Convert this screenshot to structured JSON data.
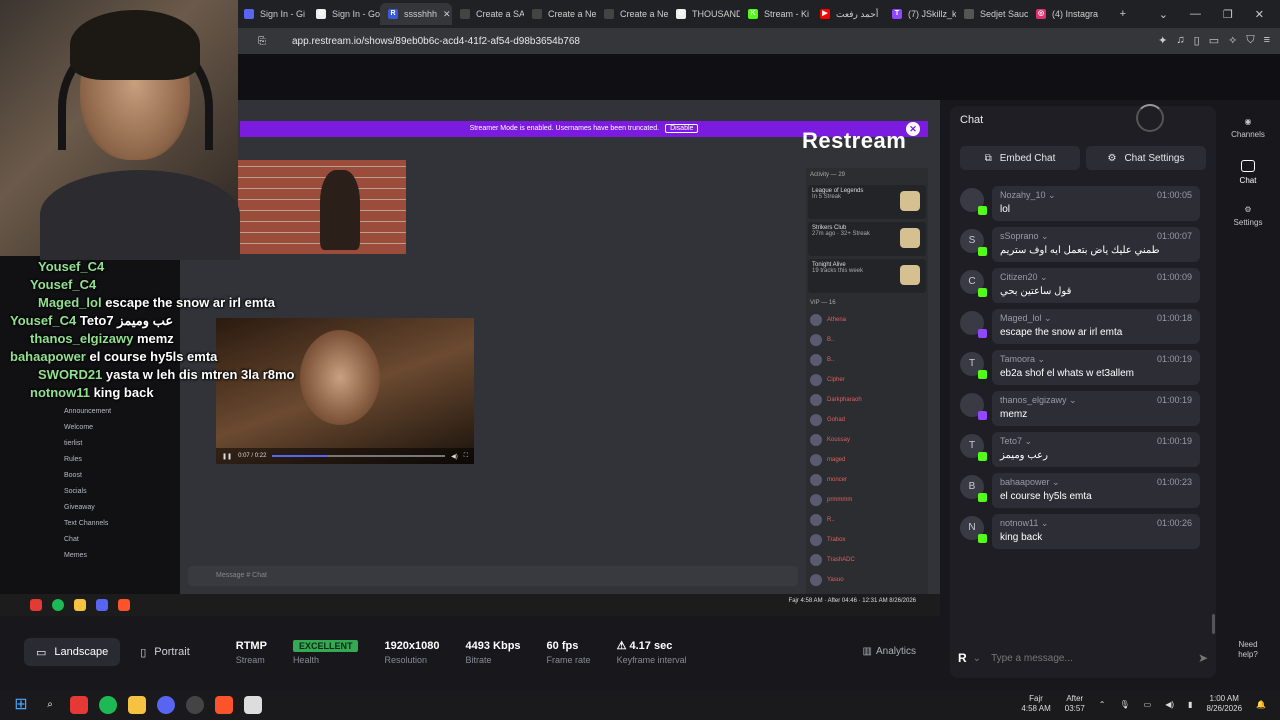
{
  "browser": {
    "tabs": [
      {
        "label": "Sign In - Gi",
        "color": "#5865f2",
        "glyph": ""
      },
      {
        "label": "Sign In - Go",
        "color": "#eee",
        "glyph": "G"
      },
      {
        "label": "sssshhh",
        "color": "#3b5bdb",
        "glyph": "R",
        "active": true
      },
      {
        "label": "Create a SA",
        "color": "#444",
        "glyph": ""
      },
      {
        "label": "Create a Ne",
        "color": "#444",
        "glyph": ""
      },
      {
        "label": "Create a Ne",
        "color": "#444",
        "glyph": ""
      },
      {
        "label": "THOUSAND",
        "color": "#eee",
        "glyph": "G"
      },
      {
        "label": "Stream - Ki",
        "color": "#53fc18",
        "glyph": "K"
      },
      {
        "label": "أحمد رفعت",
        "color": "#ff0000",
        "glyph": "▶"
      },
      {
        "label": "(7) JSkillz_k",
        "color": "#9146ff",
        "glyph": "T"
      },
      {
        "label": "Sedjet Sauc",
        "color": "#555",
        "glyph": ""
      },
      {
        "label": "(4) Instagra",
        "color": "#e1306c",
        "glyph": "◎"
      }
    ],
    "url": "app.restream.io/shows/89eb0b6c-acd4-41f2-af54-d98b3654b768"
  },
  "preview": {
    "streamer_mode": "Streamer Mode is enabled. Usernames have been truncated.",
    "disable": "Disable",
    "brand": "Restream",
    "video_time": "0:07 / 0:22",
    "video_progress": 0.32,
    "activity_title": "Activity — 29",
    "activity": [
      {
        "name": "League of Legends",
        "sub": "In 5 Streak"
      },
      {
        "name": "Strikers Club",
        "sub": "27m ago · 32+ Streak"
      },
      {
        "name": "Tonight Alive",
        "sub": "19 tracks this week"
      }
    ],
    "vip_title": "VIP — 16",
    "members": [
      "Athena",
      "B..",
      "B..",
      "Cipher",
      "Darkpharaoh",
      "Gohad",
      "Koussay",
      "maged",
      "moncer",
      "prmmmm",
      "R..",
      "Trabox",
      "TrashADC",
      "Yasuo"
    ],
    "overlay": [
      {
        "user": "Yousef_C4",
        "text": ""
      },
      {
        "user": "Yousef_C4",
        "text": ""
      },
      {
        "user": "Maged_lol",
        "text": "escape the snow ar irl emta"
      },
      {
        "user": "Yousef_C4",
        "text": "Teto7 عب وميمز"
      },
      {
        "user": "thanos_elgizawy",
        "text": "memz"
      },
      {
        "user": "bahaapower",
        "text": "el course hy5ls emta"
      },
      {
        "user": "SWORD21",
        "text": "yasta w leh dis mtren 3la r8mo"
      },
      {
        "user": "notnow11",
        "text": "king back"
      }
    ],
    "channels": [
      "Announcement",
      "Welcome",
      "tierlist",
      "Rules",
      "Boost",
      "Socials",
      "Giveaway",
      "Text Channels",
      "Chat",
      "Memes"
    ],
    "message_placeholder": "Message # Chat",
    "inner_clock": [
      "Fajr 4:58 AM",
      "After 04:46",
      "12:31 AM 8/26/2026"
    ]
  },
  "stats": {
    "landscape": "Landscape",
    "portrait": "Portrait",
    "protocol": "RTMP",
    "protocol_l": "Stream",
    "health": "EXCELLENT",
    "health_l": "Health",
    "resolution": "1920x1080",
    "resolution_l": "Resolution",
    "bitrate": "4493 Kbps",
    "bitrate_l": "Bitrate",
    "fps": "60 fps",
    "fps_l": "Frame rate",
    "keyframe": "4.17 sec",
    "keyframe_l": "Keyframe interval",
    "analytics": "Analytics"
  },
  "chat": {
    "title": "Chat",
    "embed": "Embed Chat",
    "settings": "Chat Settings",
    "placeholder": "Type a message...",
    "messages": [
      {
        "user": "Nozahy_10",
        "time": "01:00:05",
        "text": "lol",
        "platform": "kick",
        "initial": ""
      },
      {
        "user": "sSoprano",
        "time": "01:00:07",
        "text": "طمني عليك ياض بتعمل ايه اوف ستريم",
        "platform": "kick",
        "initial": "S"
      },
      {
        "user": "Citizen20",
        "time": "01:00:09",
        "text": "قول ساعتين بحي",
        "platform": "kick",
        "initial": "C"
      },
      {
        "user": "Maged_lol",
        "time": "01:00:18",
        "text": "escape the snow ar irl emta",
        "platform": "twitch",
        "initial": ""
      },
      {
        "user": "Tamoora",
        "time": "01:00:19",
        "text": "eb2a shof el whats w et3allem",
        "platform": "kick",
        "initial": "T"
      },
      {
        "user": "thanos_elgizawy",
        "time": "01:00:19",
        "text": "memz",
        "platform": "twitch",
        "initial": ""
      },
      {
        "user": "Teto7",
        "time": "01:00:19",
        "text": "رعب وميمز",
        "platform": "kick",
        "initial": "T"
      },
      {
        "user": "bahaapower",
        "time": "01:00:23",
        "text": "el course hy5ls emta",
        "platform": "kick",
        "initial": "B"
      },
      {
        "user": "notnow11",
        "time": "01:00:26",
        "text": "king back",
        "platform": "kick",
        "initial": "N"
      }
    ]
  },
  "rail": {
    "channels": "Channels",
    "chat": "Chat",
    "settings": "Settings",
    "help": "Need help?"
  },
  "taskbar": {
    "prayer": "Fajr",
    "prayer_time": "4:58 AM",
    "after": "After",
    "after_time": "03:57",
    "time": "1:00 AM",
    "date": "8/26/2026"
  },
  "colors": {
    "kick": "#53fc18",
    "twitch": "#9146ff",
    "streamer_mode": "#7c1be0",
    "excellent": "#34a853",
    "warning": "#f5b942"
  }
}
